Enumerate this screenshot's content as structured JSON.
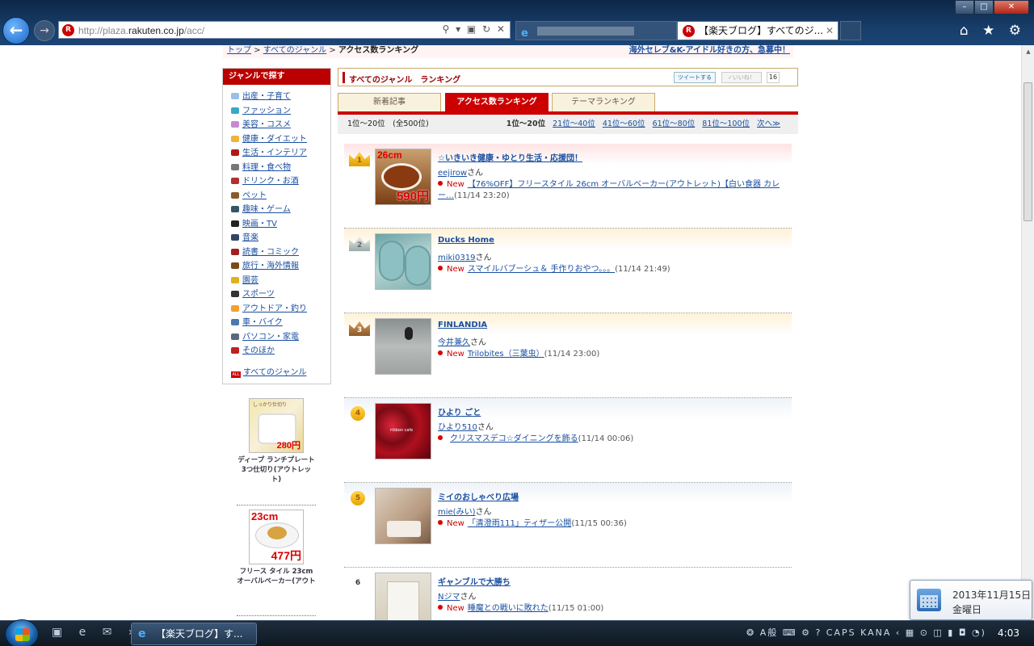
{
  "browser": {
    "address_url_prefix": "http://plaza.",
    "address_url_domain": "rakuten.co.jp",
    "address_url_path": "/acc/",
    "address_controls": "⚲ ▾ ▣ ↻ ✕",
    "tab_active_title": "【楽天ブログ】すべてのジ...",
    "tab_close": "✕",
    "icon_r": "R",
    "icon_e": "e",
    "tools": "⌂ ★ ⚙"
  },
  "breadcrumb": {
    "top": "トップ",
    "sep": " > ",
    "all_genres": "すべてのジャンル",
    "current": "アクセス数ランキング",
    "promo": "海外セレブ&K-アイドル好きの方、急募中！"
  },
  "sidebar": {
    "heading": "ジャンルで探す",
    "items": [
      {
        "label": "出産・子育て",
        "color": "#9ac0e8"
      },
      {
        "label": "ファッション",
        "color": "#3aa7c8"
      },
      {
        "label": "美容・コスメ",
        "color": "#c48bd2"
      },
      {
        "label": "健康・ダイエット",
        "color": "#f2b13a"
      },
      {
        "label": "生活・インテリア",
        "color": "#b01818"
      },
      {
        "label": "料理・食べ物",
        "color": "#777777"
      },
      {
        "label": "ドリンク・お酒",
        "color": "#b03030"
      },
      {
        "label": "ペット",
        "color": "#8a5a2a"
      },
      {
        "label": "趣味・ゲーム",
        "color": "#356"
      },
      {
        "label": "映画・TV",
        "color": "#222222"
      },
      {
        "label": "音楽",
        "color": "#334466"
      },
      {
        "label": "読書・コミック",
        "color": "#a02020"
      },
      {
        "label": "旅行・海外情報",
        "color": "#7a4a1a"
      },
      {
        "label": "園芸",
        "color": "#e0b020"
      },
      {
        "label": "スポーツ",
        "color": "#333333"
      },
      {
        "label": "アウトドア・釣り",
        "color": "#f0a030"
      },
      {
        "label": "車・バイク",
        "color": "#4a7ab0"
      },
      {
        "label": "パソコン・家電",
        "color": "#5a6a7a"
      },
      {
        "label": "そのほか",
        "color": "#c02020"
      }
    ],
    "all_label": "すべてのジャンル",
    "all_icon_text": "ALL"
  },
  "ads": [
    {
      "caption": "ディープ ランチプレート 3つ仕切り(アウトレット)",
      "price": "280円",
      "top_text": "しっかり仕切り"
    },
    {
      "caption": "フリース タイル 23cm オーバルベーカー(アウト",
      "size": "23cm",
      "price": "477円"
    }
  ],
  "main": {
    "heading": "すべてのジャンル　ランキング",
    "tweet": "ツイートする",
    "like": "✓いいね！",
    "like_count": "16",
    "tabs": [
      "新着記事",
      "アクセス数ランキング",
      "テーマランキング"
    ],
    "active_tab": 1,
    "pager": {
      "count": "1位〜20位　(全500位)",
      "current": "1位〜20位",
      "links": [
        "21位〜40位",
        "41位〜60位",
        "61位〜80位",
        "81位〜100位",
        "次へ≫"
      ]
    }
  },
  "ranking": [
    {
      "rank": "1",
      "title": "☆いきいき健康・ゆとり生活・応援団！",
      "user": "eejirow",
      "suffix": "さん",
      "new": "New",
      "post": "【76%OFF】フリースタイル 26cm オーバルベーカー(アウトレット)【白い食器 カレー…",
      "date": "(11/14 23:20)",
      "thumb_size": "26cm",
      "thumb_price": "590円",
      "bg": "#fde3e3"
    },
    {
      "rank": "2",
      "title": "Ducks Home",
      "user": "miki0319",
      "suffix": "さん",
      "new": "New",
      "post": "スマイルバブーシュ＆ 手作りおやつ。。。",
      "date": "(11/14 21:49)",
      "bg": "#fff1d6"
    },
    {
      "rank": "3",
      "title": "FINLANDIA",
      "user": "今井兼久",
      "suffix": "さん",
      "new": "New",
      "post": "Trilobites（三葉虫）",
      "date": "(11/14 23:00)",
      "bg": "#fff1d6"
    },
    {
      "rank": "4",
      "title": "ひより ごと",
      "user": "ひより510",
      "suffix": "さん",
      "new": "",
      "post": "クリスマスデコ☆ダイニングを飾る",
      "date": "(11/14 00:06)",
      "thumb_text": "ribbon cafe",
      "bg": "#eef3f8"
    },
    {
      "rank": "5",
      "title": "ミイのおしゃべり広場",
      "user": "mie(みい)",
      "suffix": "さん",
      "new": "New",
      "post": "「清澄雨111」ティザー公開",
      "date": "(11/15 00:36)",
      "bg": "#eef3f8"
    },
    {
      "rank": "6",
      "title": "ギャンブルで大勝ち",
      "user": "Nジマ",
      "suffix": "さん",
      "new": "New",
      "post": "睡魔との戦いに敗れた",
      "date": "(11/15 01:00)",
      "bg": "#ffffff"
    }
  ],
  "taskbar": {
    "quicklaunch": "▣ e ✉ »",
    "task_label": "【楽天ブログ】す...",
    "tray": "❂ A般 ⌨ ⚙ ? CAPS KANA ‹ ▦ ⊙ ◫ ▮ ◘ ◔)",
    "time": "4:03"
  },
  "date_popup": {
    "date": "2013年11月15日",
    "weekday": "金曜日"
  }
}
